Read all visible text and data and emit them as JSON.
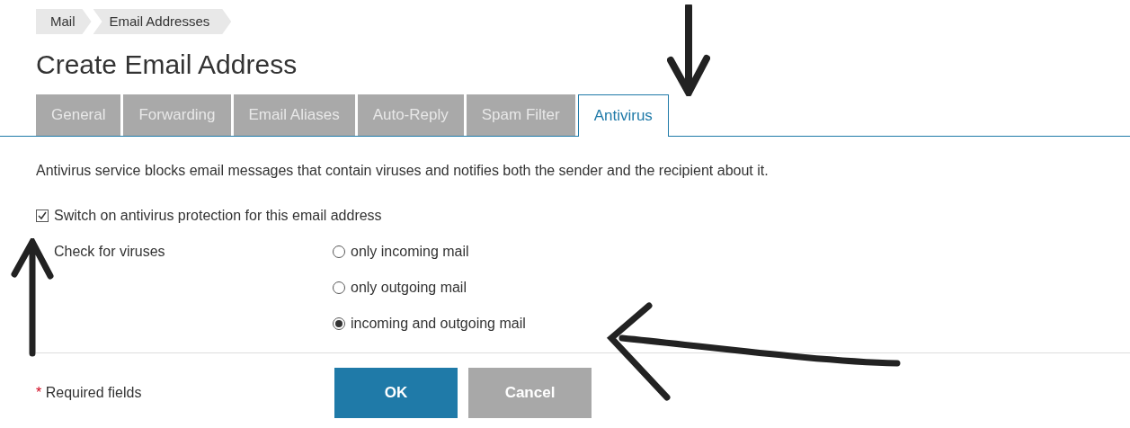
{
  "breadcrumb": [
    "Mail",
    "Email Addresses"
  ],
  "title": "Create Email Address",
  "tabs": [
    {
      "label": "General",
      "selected": false
    },
    {
      "label": "Forwarding",
      "selected": false
    },
    {
      "label": "Email Aliases",
      "selected": false
    },
    {
      "label": "Auto-Reply",
      "selected": false
    },
    {
      "label": "Spam Filter",
      "selected": false
    },
    {
      "label": "Antivirus",
      "selected": true
    }
  ],
  "description": "Antivirus service blocks email messages that contain viruses and notifies both the sender and the recipient about it.",
  "protection": {
    "label": "Switch on antivirus protection for this email address",
    "checked": true
  },
  "check": {
    "label": "Check for viruses",
    "options": [
      {
        "label": "only incoming mail",
        "selected": false
      },
      {
        "label": "only outgoing mail",
        "selected": false
      },
      {
        "label": "incoming and outgoing mail",
        "selected": true
      }
    ]
  },
  "required": {
    "mark": "*",
    "label": "Required fields"
  },
  "buttons": [
    {
      "label": "OK",
      "kind": "primary"
    },
    {
      "label": "Cancel",
      "kind": "secondary"
    }
  ]
}
